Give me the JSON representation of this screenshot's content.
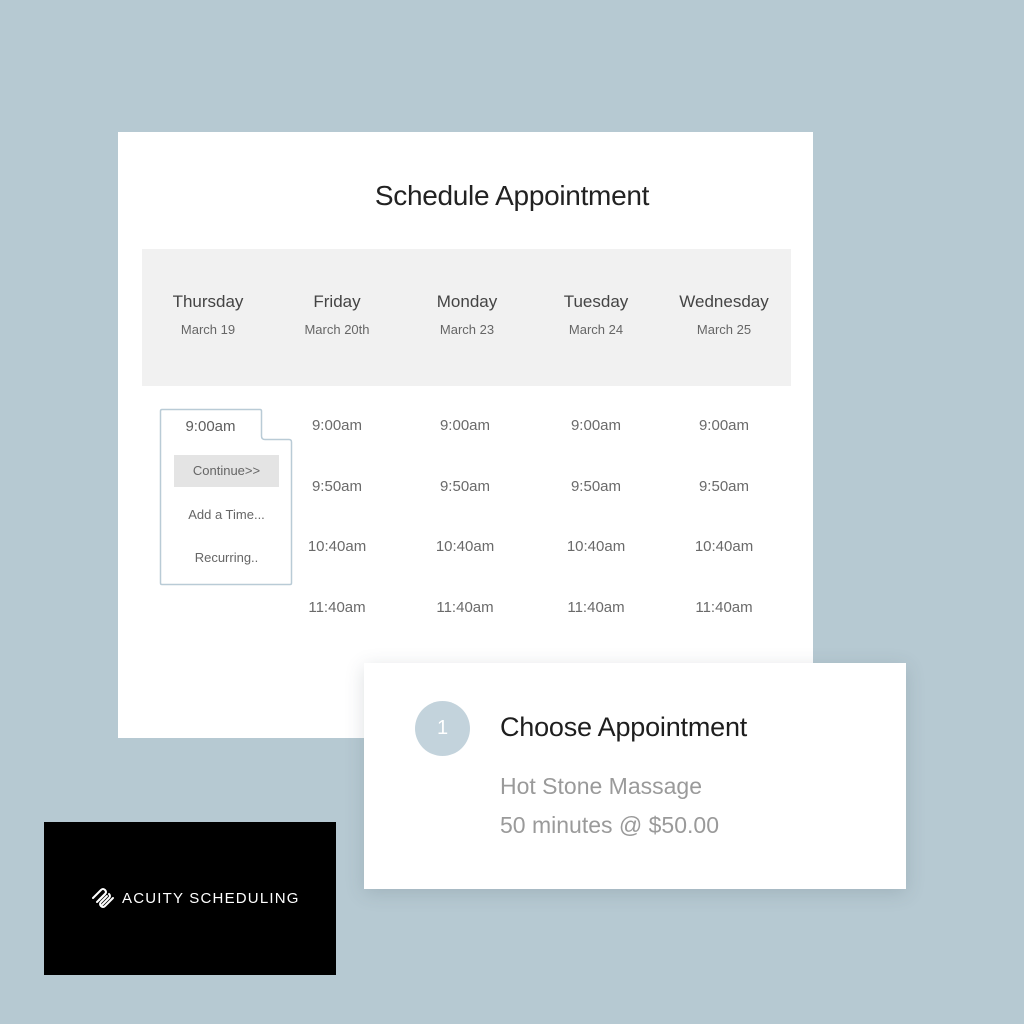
{
  "main": {
    "title": "Schedule Appointment",
    "days": [
      {
        "name": "Thursday",
        "date": "March 19"
      },
      {
        "name": "Friday",
        "date": "March 20th"
      },
      {
        "name": "Monday",
        "date": "March 23"
      },
      {
        "name": "Tuesday",
        "date": "March 24"
      },
      {
        "name": "Wednesday",
        "date": "March 25"
      }
    ],
    "slots": [
      "9:00am",
      "9:50am",
      "10:40am",
      "11:40am"
    ]
  },
  "popup": {
    "selected_time": "9:00am",
    "continue_label": "Continue>>",
    "add_time_label": "Add a Time...",
    "recurring_label": "Recurring.."
  },
  "choose": {
    "step_number": "1",
    "title": "Choose Appointment",
    "service_name": "Hot Stone Massage",
    "service_detail": "50 minutes @ $50.00"
  },
  "logo": {
    "icon": "squarespace-knot-icon",
    "text": "ACUITY SCHEDULING"
  },
  "colors": {
    "background": "#b6c9d2",
    "header_bg": "#f1f1f1",
    "step_circle": "#c3d3dc",
    "popup_border": "#b9cbd6"
  }
}
